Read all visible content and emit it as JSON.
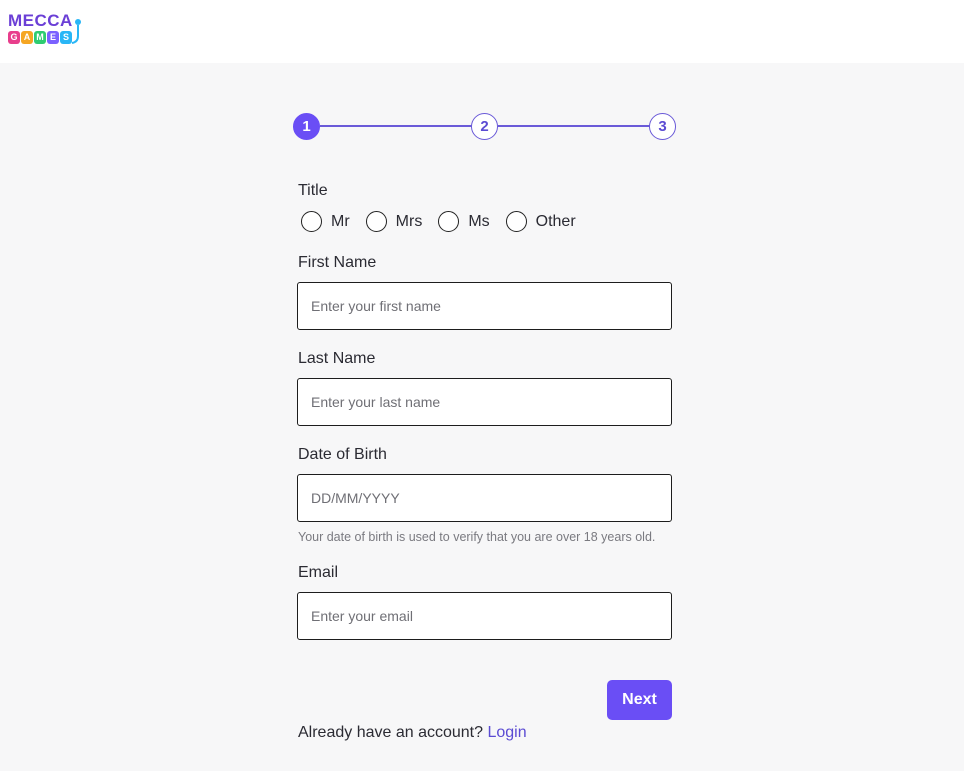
{
  "brand": {
    "logo_top": "MECCA",
    "logo_bottom": [
      "G",
      "A",
      "M",
      "E",
      "S"
    ],
    "tile_colors": [
      "#e83e8c",
      "#f5a623",
      "#2ecc71",
      "#7b61ff",
      "#29b6f6"
    ],
    "accent": "#6a4ef5"
  },
  "stepper": {
    "steps": [
      {
        "number": "1",
        "state": "active"
      },
      {
        "number": "2",
        "state": "pending"
      },
      {
        "number": "3",
        "state": "pending"
      }
    ]
  },
  "form": {
    "title_label": "Title",
    "title_options": [
      "Mr",
      "Mrs",
      "Ms",
      "Other"
    ],
    "first_name": {
      "label": "First Name",
      "placeholder": "Enter your first name",
      "value": ""
    },
    "last_name": {
      "label": "Last Name",
      "placeholder": "Enter your last name",
      "value": ""
    },
    "dob": {
      "label": "Date of Birth",
      "placeholder": "DD/MM/YYYY",
      "value": "",
      "hint": "Your date of birth is used to verify that you are over 18 years old."
    },
    "email": {
      "label": "Email",
      "placeholder": "Enter your email",
      "value": ""
    },
    "next_label": "Next"
  },
  "footer": {
    "prompt": "Already have an account?",
    "login_label": "Login"
  }
}
